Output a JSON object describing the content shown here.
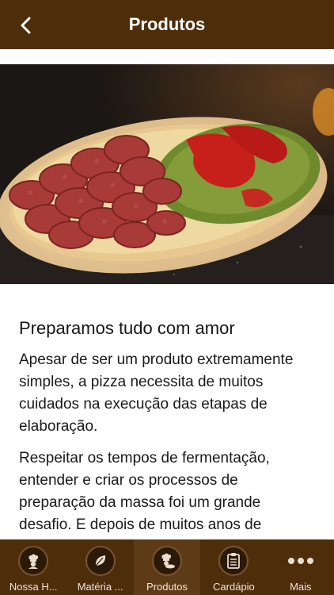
{
  "header": {
    "title": "Produtos"
  },
  "hero": {
    "alt": "Pizza com calabresa e pesto sendo preparada"
  },
  "article": {
    "heading": "Preparamos tudo com amor",
    "paragraphs": [
      "Apesar de ser um produto extremamente simples, a pizza necessita de muitos cuidados na execução das etapas de elaboração.",
      "Respeitar os tempos de fermentação, entender e criar os processos de preparação da massa foi um grande desafio. E depois de muitos anos de"
    ]
  },
  "tabbar": {
    "tabs": [
      {
        "label": "Nossa H...",
        "icon": "chef-icon"
      },
      {
        "label": "Matéria ...",
        "icon": "leaf-icon"
      },
      {
        "label": "Produtos",
        "icon": "chef-pizza-icon"
      },
      {
        "label": "Cardápio",
        "icon": "clipboard-icon"
      },
      {
        "label": "Mais",
        "icon": "more-icon"
      }
    ]
  },
  "colors": {
    "header_bg": "#4e2d0b",
    "tabbar_bg": "#4e2d0b",
    "active_tab_bg": "#5e3b17",
    "text": "#1a1a1a"
  }
}
